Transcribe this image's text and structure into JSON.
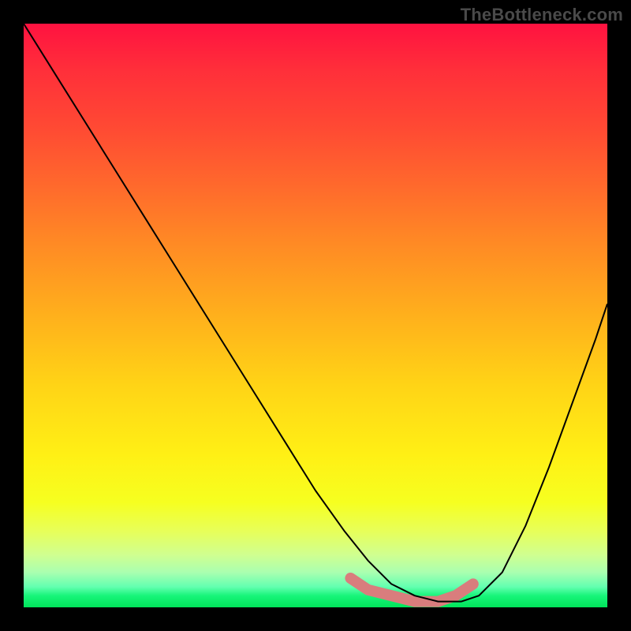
{
  "watermark": "TheBottleneck.com",
  "chart_data": {
    "type": "line",
    "title": "",
    "xlabel": "",
    "ylabel": "",
    "xlim": [
      0,
      100
    ],
    "ylim": [
      0,
      100
    ],
    "x": [
      0,
      5,
      10,
      15,
      20,
      25,
      30,
      35,
      40,
      45,
      50,
      55,
      59,
      63,
      67,
      71,
      75,
      78,
      82,
      86,
      90,
      94,
      98,
      100
    ],
    "y": [
      100,
      92,
      84,
      76,
      68,
      60,
      52,
      44,
      36,
      28,
      20,
      13,
      8,
      4,
      2,
      1,
      1,
      2,
      6,
      14,
      24,
      35,
      46,
      52
    ],
    "highlight_segment": {
      "x": [
        56,
        59,
        63,
        67,
        71,
        74,
        77
      ],
      "y": [
        5,
        3,
        2,
        1,
        1,
        2,
        4
      ]
    },
    "gradient_stops": [
      {
        "offset": 0.0,
        "color": "#ff1240"
      },
      {
        "offset": 0.5,
        "color": "#ffb01c"
      },
      {
        "offset": 0.82,
        "color": "#f6ff20"
      },
      {
        "offset": 1.0,
        "color": "#00e45a"
      }
    ],
    "colors": {
      "line": "#000000",
      "highlight": "#d97d7d",
      "frame": "#000000"
    }
  }
}
